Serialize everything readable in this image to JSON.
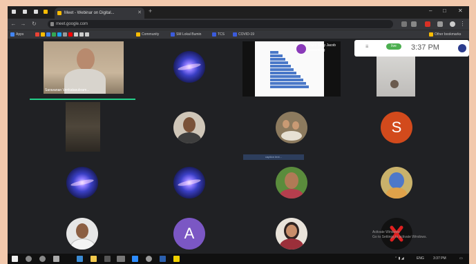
{
  "browser": {
    "tab_title": "Meet - Webinar on Digital...",
    "url": "meet.google.com",
    "new_tab": "+",
    "window_controls": [
      "–",
      "□",
      "✕"
    ],
    "bookmarks": [
      "Apps",
      "Community",
      "SM Lokal Bumin",
      "TCS",
      "COVID-19",
      "Other bookmarks"
    ]
  },
  "meet": {
    "participants": [
      {
        "type": "video",
        "name": "Saravanan Venkatasubram..."
      },
      {
        "type": "galaxy"
      },
      {
        "type": "presentation",
        "label_line1": "Fairy Story Jacob",
        "label_line2": "presenting"
      },
      {
        "type": "video-dim"
      },
      {
        "type": "video-dark"
      },
      {
        "type": "photo"
      },
      {
        "type": "photo"
      },
      {
        "type": "letter",
        "letter": "S",
        "color": "#d24a1c"
      },
      {
        "type": "galaxy"
      },
      {
        "type": "galaxy"
      },
      {
        "type": "photo"
      },
      {
        "type": "photo"
      },
      {
        "type": "photo"
      },
      {
        "type": "letter",
        "letter": "A",
        "color": "#7b57c4"
      },
      {
        "type": "photo"
      },
      {
        "type": "logo"
      }
    ],
    "notification": {
      "chip": "live",
      "time": "3:37 PM"
    },
    "caption": "caption text...",
    "activate_windows": {
      "line1": "Activate Windows",
      "line2": "Go to Settings to activate Windows."
    }
  },
  "taskbar": {
    "time": "3:37 PM",
    "lang": "ENG"
  },
  "colors": {
    "meet_bg": "#202124",
    "speaking": "#23d18b",
    "frame": "#f2c9ad"
  }
}
